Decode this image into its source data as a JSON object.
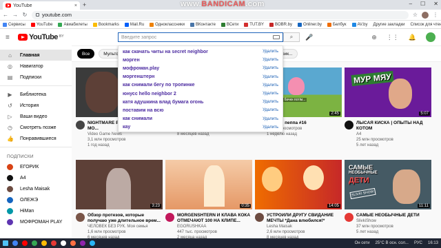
{
  "browser": {
    "tab_title": "YouTube",
    "tab_close": "×",
    "newtab": "+",
    "url": "youtube.com",
    "back": "←",
    "forward": "→",
    "reload": "↻",
    "star": "☆",
    "win_min": "–",
    "win_max": "☐",
    "win_close": "✕",
    "menu": "⋮"
  },
  "watermark": {
    "prefix": "www.",
    "brand": "BANDICAM",
    "suffix": ".com"
  },
  "bookmarks": [
    {
      "label": "Сервисы",
      "color": "#4285f4"
    },
    {
      "label": "YouTube",
      "color": "#ff0000"
    },
    {
      "label": "Авиабилеты",
      "color": "#34a853"
    },
    {
      "label": "Bookmarks",
      "color": "#fbbc05"
    },
    {
      "label": "Mail.Ru",
      "color": "#005ff9"
    },
    {
      "label": "Одноклассники",
      "color": "#ee8208"
    },
    {
      "label": "ВКонтакте",
      "color": "#4a76a8"
    },
    {
      "label": "ВСети",
      "color": "#2e7d32"
    },
    {
      "label": "TUT.BY",
      "color": "#d32f2f"
    },
    {
      "label": "BOBR.by",
      "color": "#c62828"
    },
    {
      "label": "Onliner.by",
      "color": "#1565c0"
    },
    {
      "label": "Белбук",
      "color": "#ef6c00"
    },
    {
      "label": "AV.by",
      "color": "#1e88e5"
    }
  ],
  "bookmarks_right": [
    "Другие закладки",
    "Список для чтения"
  ],
  "header": {
    "burger": "≡",
    "logo": "YouTube",
    "logo_cc": "BY",
    "search_placeholder": "Введите запрос",
    "search_icon": "⌕",
    "mic_icon": "🎤",
    "create_icon": "⊕",
    "apps_icon": "⋮⋮",
    "bell_icon": "🔔"
  },
  "sidebar": {
    "items": [
      {
        "label": "Главная",
        "icon": "⌂",
        "active": true
      },
      {
        "label": "Навигатор",
        "icon": "◎"
      },
      {
        "label": "Подписки",
        "icon": "▤"
      }
    ],
    "library": [
      {
        "label": "Библиотека",
        "icon": "▶"
      },
      {
        "label": "История",
        "icon": "↺"
      },
      {
        "label": "Ваши видео",
        "icon": "▷"
      },
      {
        "label": "Смотреть позже",
        "icon": "◷"
      },
      {
        "label": "Понравившиеся",
        "icon": "👍"
      }
    ],
    "subs_heading": "ПОДПИСКИ",
    "subs": [
      {
        "label": "ЕГОРИК",
        "color": "#d84315"
      },
      {
        "label": "A4",
        "color": "#111111"
      },
      {
        "label": "Lesha Maisak",
        "color": "#6d4c41"
      },
      {
        "label": "ОЛЕЖЭ",
        "color": "#1565c0"
      },
      {
        "label": "HiMan",
        "color": "#0097a7"
      },
      {
        "label": "МОФРОМАН PLAY",
        "color": "#5e35b1"
      }
    ]
  },
  "chips": [
    "Все",
    "Мультфил...",
    "...дификации Minecraft",
    "Домашние животные",
    "Экшен и прик..."
  ],
  "suggestions": [
    "как скачать читы на secret neighbor",
    "морген",
    "мофроман.play",
    "моргенштерн",
    "как снимали бегу по тропинке",
    "юнусс hello neighbor 2",
    "катя адушкина влад бумага огонь",
    "поставим на всю",
    "как снимали",
    "кау"
  ],
  "suggestion_delete": "Удалить",
  "videos": [
    {
      "title": "NIGHTMARE PL... NEIGHBOR MO...",
      "channel": "Video Game News",
      "views": "3,1 млн просмотров",
      "age": "1 год назад",
      "duration": "",
      "thumb": "#3b3b3b",
      "av": "#444444"
    },
    {
      "title": "",
      "channel": "АРИШНЕВ И БРУНО",
      "views": "2,8 млн просмотров",
      "age": "8 месяцев назад",
      "duration": "",
      "thumb": "#7a6a5a",
      "av": "#999999"
    },
    {
      "title": "...енная пеппа #16",
      "channel": "",
      "views": "...тыс. просмотров",
      "age": "1 неделю назад",
      "duration": "2:45",
      "thumb": "#5aa8d0",
      "av": "#ff80ab"
    },
    {
      "title": "ЛЫСАЯ КИСКА | ОПЫТЫ НАД КОТОМ",
      "channel": "A4",
      "views": "25 млн просмотров",
      "age": "5 лет назад",
      "duration": "5:07",
      "thumb": "#6a1b9a",
      "av": "#111111"
    },
    {
      "title": "Обзор протезов, которые получаю уже длительное врем...",
      "channel": "ЧЕЛОВЕК БЕЗ РУК. Моя семья",
      "views": "1,6 млн просмотров",
      "age": "6 месяцев назад",
      "duration": "3:23",
      "thumb": "#5d4037",
      "av": "#795548"
    },
    {
      "title": "MORGENSHTERN И КЛАВА КОКА ОТМЕЧАЮТ 100 НА КЛИПЕ...",
      "channel": "EGORUSHKAA",
      "views": "447 тыс. просмотров",
      "age": "2 месяца назад",
      "duration": "0:35",
      "thumb": "#d9a07a",
      "av": "#c2185b"
    },
    {
      "title": "УСТРОИЛИ ДРУГУ СВИДАНИЕ МЕЧТЫ *Дана влюбился!*",
      "channel": "Lesha Maisak",
      "views": "2,6 млн просмотров",
      "age": "8 месяцев назад",
      "duration": "14:05",
      "thumb": "#c62828",
      "av": "#6d4c41"
    },
    {
      "title": "САМЫЕ НЕОБЫЧНЫЕ ДЕТИ",
      "channel": "SlivkiShow",
      "views": "37 млн просмотров",
      "age": "5 лет назад",
      "duration": "11:11",
      "thumb": "#455a64",
      "av": "#e53935"
    }
  ],
  "thumb_text": {
    "murmau": "МУР МЯУ",
    "peppa": "Яра бачкн потім...",
    "kids1": "САМЫЕ",
    "kids2": "НЕОБЫЧНЫЕ",
    "kids3": "ДЕТИ",
    "slivki": "SLIVKI SHOW"
  },
  "taskbar": {
    "items": [
      "#4285f4",
      "#ff0000",
      "#34a853",
      "#fbbc05",
      "#e53935",
      "#ffffff",
      "#ff7043",
      "#8e24aa",
      "#29b6f6"
    ],
    "status": "Он сети",
    "temp": "25°C  В осн. сол...",
    "lang": "РУС",
    "time": "16:13"
  }
}
